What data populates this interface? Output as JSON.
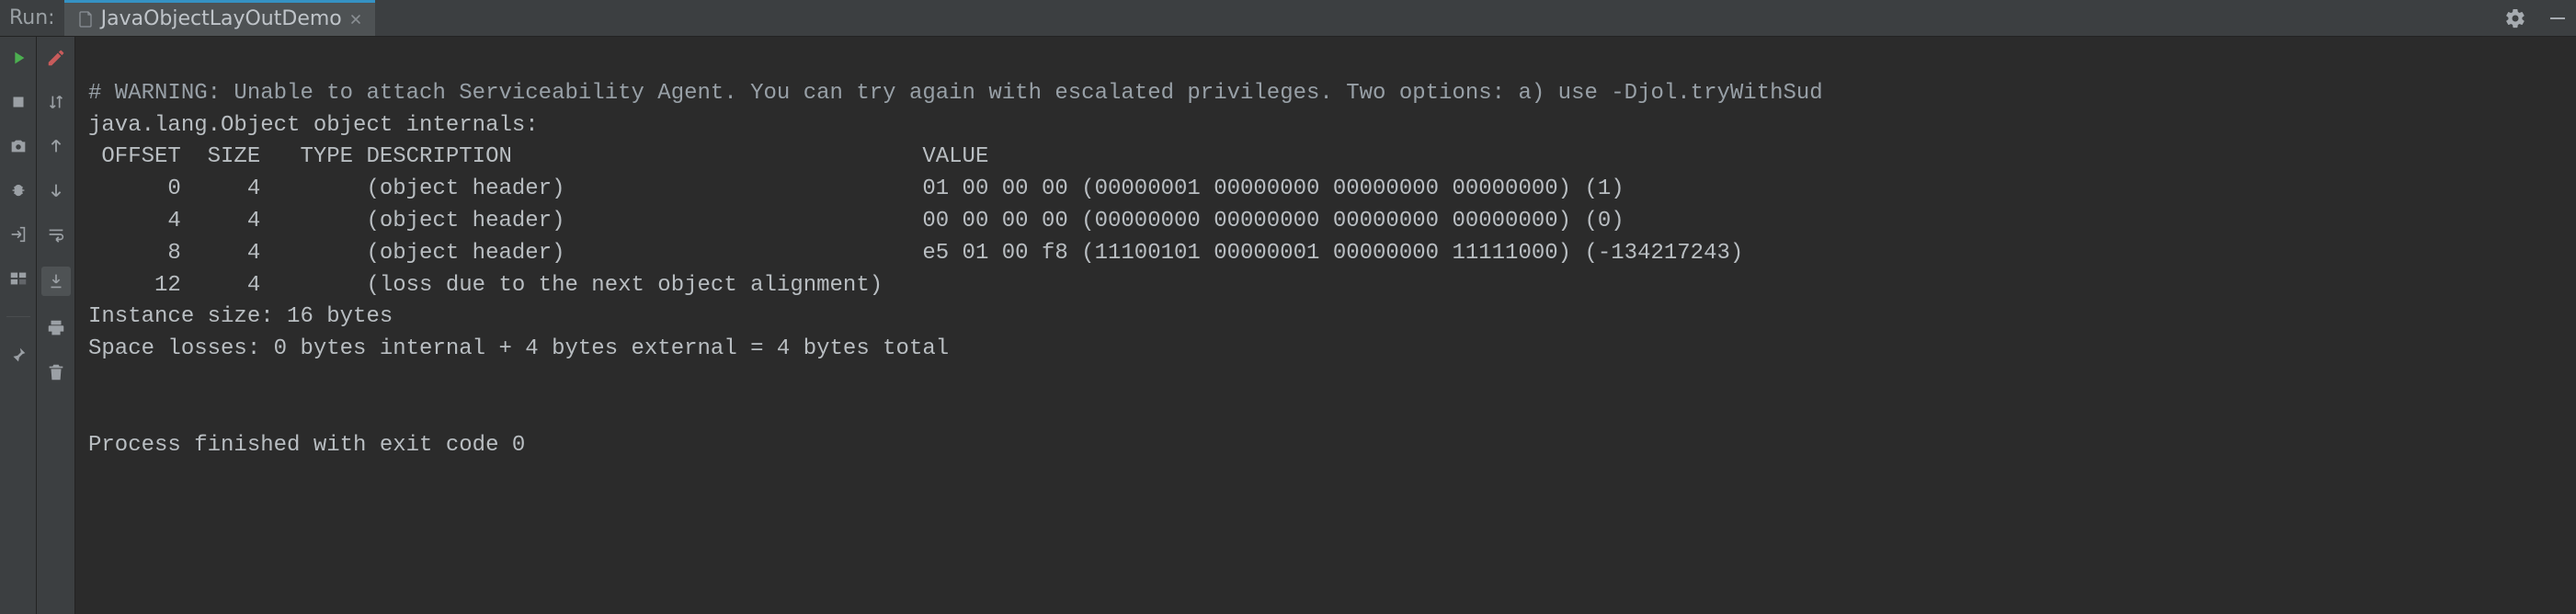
{
  "header": {
    "label": "Run:",
    "tab": {
      "name": "JavaObjectLayOutDemo"
    }
  },
  "console": {
    "warning": "# WARNING: Unable to attach Serviceability Agent. You can try again with escalated privileges. Two options: a) use -Djol.tryWithSud",
    "line_internals": "java.lang.Object object internals:",
    "columns": " OFFSET  SIZE   TYPE DESCRIPTION                               VALUE",
    "rows": [
      "      0     4        (object header)                           01 00 00 00 (00000001 00000000 00000000 00000000) (1)",
      "      4     4        (object header)                           00 00 00 00 (00000000 00000000 00000000 00000000) (0)",
      "      8     4        (object header)                           e5 01 00 f8 (11100101 00000001 00000000 11111000) (-134217243)",
      "     12     4        (loss due to the next object alignment)"
    ],
    "instance_size": "Instance size: 16 bytes",
    "space_losses": "Space losses: 0 bytes internal + 4 bytes external = 4 bytes total",
    "exit": "Process finished with exit code 0"
  }
}
